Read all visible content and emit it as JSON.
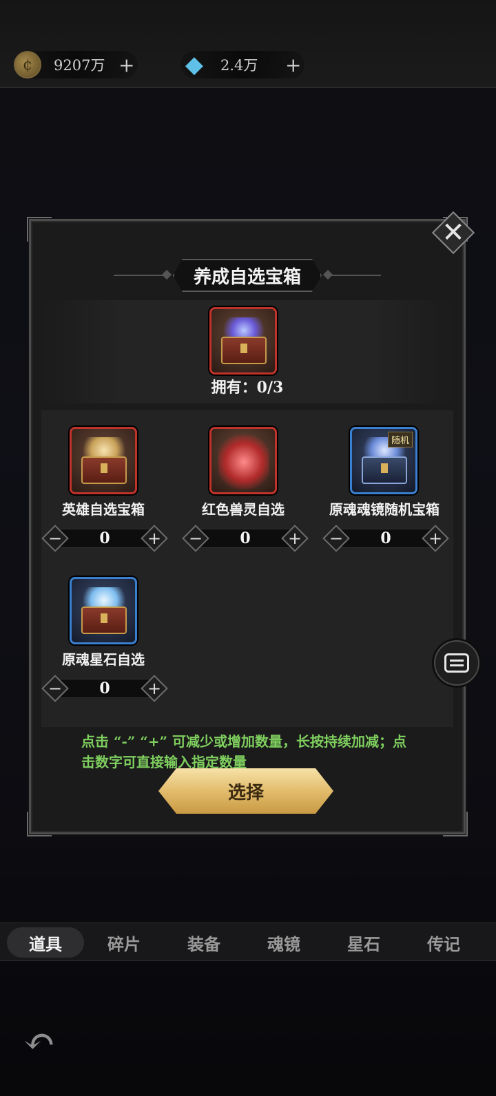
{
  "resources": {
    "gold": "9207万",
    "gems": "2.4万"
  },
  "dialog": {
    "title": "养成自选宝箱",
    "owned": "拥有：0/3",
    "hint": "点击 “-” “+” 可减少或增加数量，长按持续加减；点击数字可直接输入指定数量",
    "confirm_label": "选择",
    "options": [
      {
        "label": "英雄自选宝箱",
        "qty": "0",
        "frame": "red"
      },
      {
        "label": "红色兽灵自选",
        "qty": "0",
        "frame": "red"
      },
      {
        "label": "原魂魂镜随机宝箱",
        "qty": "0",
        "frame": "blue",
        "tag": "随机"
      },
      {
        "label": "原魂星石自选",
        "qty": "0",
        "frame": "blue"
      }
    ]
  },
  "tabs": [
    "道具",
    "碎片",
    "装备",
    "魂镜",
    "星石",
    "传记"
  ],
  "active_tab": "道具",
  "colors": {
    "hint_green": "#7fcf5f",
    "gold_button": "#e2bc6c",
    "red_frame": "#c0332b",
    "blue_frame": "#3b7fd1"
  }
}
